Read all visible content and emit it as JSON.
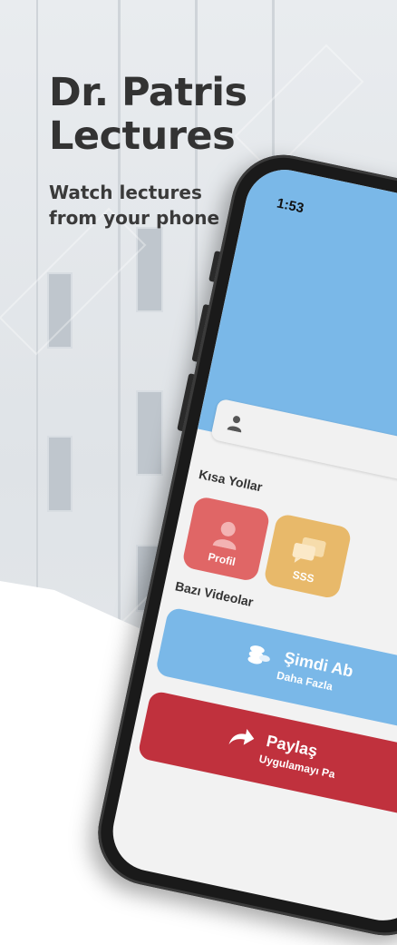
{
  "hero": {
    "title_line1": "Dr. Patris",
    "title_line2": "Lectures",
    "subtitle_line1": "Watch lectures",
    "subtitle_line2": "from your phone"
  },
  "phone": {
    "status_time": "1:53",
    "shortcuts_label": "Kısa Yollar",
    "tiles": [
      {
        "label": "Profil",
        "icon": "user-icon",
        "color": "#e06666"
      },
      {
        "label": "SSS",
        "icon": "chat-icon",
        "color": "#e8b96a"
      }
    ],
    "videos_label": "Bazı Videolar",
    "subscribe": {
      "title": "Şimdi Ab",
      "subtitle": "Daha Fazla",
      "icon": "coins-icon",
      "color": "#7ab8e8"
    },
    "share": {
      "title": "Paylaş",
      "subtitle": "Uygulamayı Pa",
      "icon": "share-arrow-icon",
      "color": "#c0313d"
    }
  },
  "colors": {
    "header_blue": "#7ab8e8",
    "headline_text": "#333333"
  }
}
